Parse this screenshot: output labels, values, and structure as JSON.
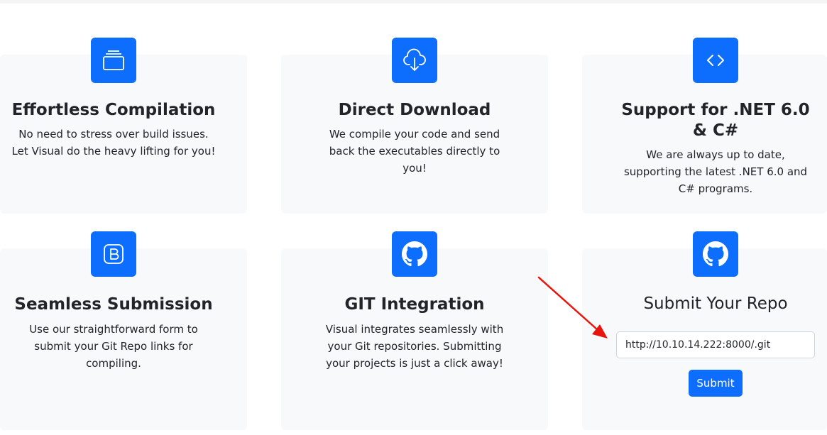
{
  "features": [
    {
      "title": "Effortless Compilation",
      "description": "No need to stress over build issues. Let Visual do the heavy lifting for you!",
      "icon": "stack-icon"
    },
    {
      "title": "Direct Download",
      "description": "We compile your code and send back the executables directly to you!",
      "icon": "cloud-download-icon"
    },
    {
      "title": "Support for .NET 6.0 & C#",
      "description": "We are always up to date, supporting the latest .NET 6.0 and C# programs.",
      "icon": "code-icon"
    },
    {
      "title": "Seamless Submission",
      "description": "Use our straightforward form to submit your Git Repo links for compiling.",
      "icon": "bootstrap-icon"
    },
    {
      "title": "GIT Integration",
      "description": "Visual integrates seamlessly with your Git repositories. Submitting your projects is just a click away!",
      "icon": "github-icon"
    }
  ],
  "submit_form": {
    "title": "Submit Your Repo",
    "repo_url_value": "http://10.10.14.222:8000/.git",
    "submit_label": "Submit",
    "icon": "github-icon"
  },
  "colors": {
    "accent": "#0d6efd",
    "card_bg": "#f8f9fa",
    "annotation_arrow": "#e8150f"
  }
}
